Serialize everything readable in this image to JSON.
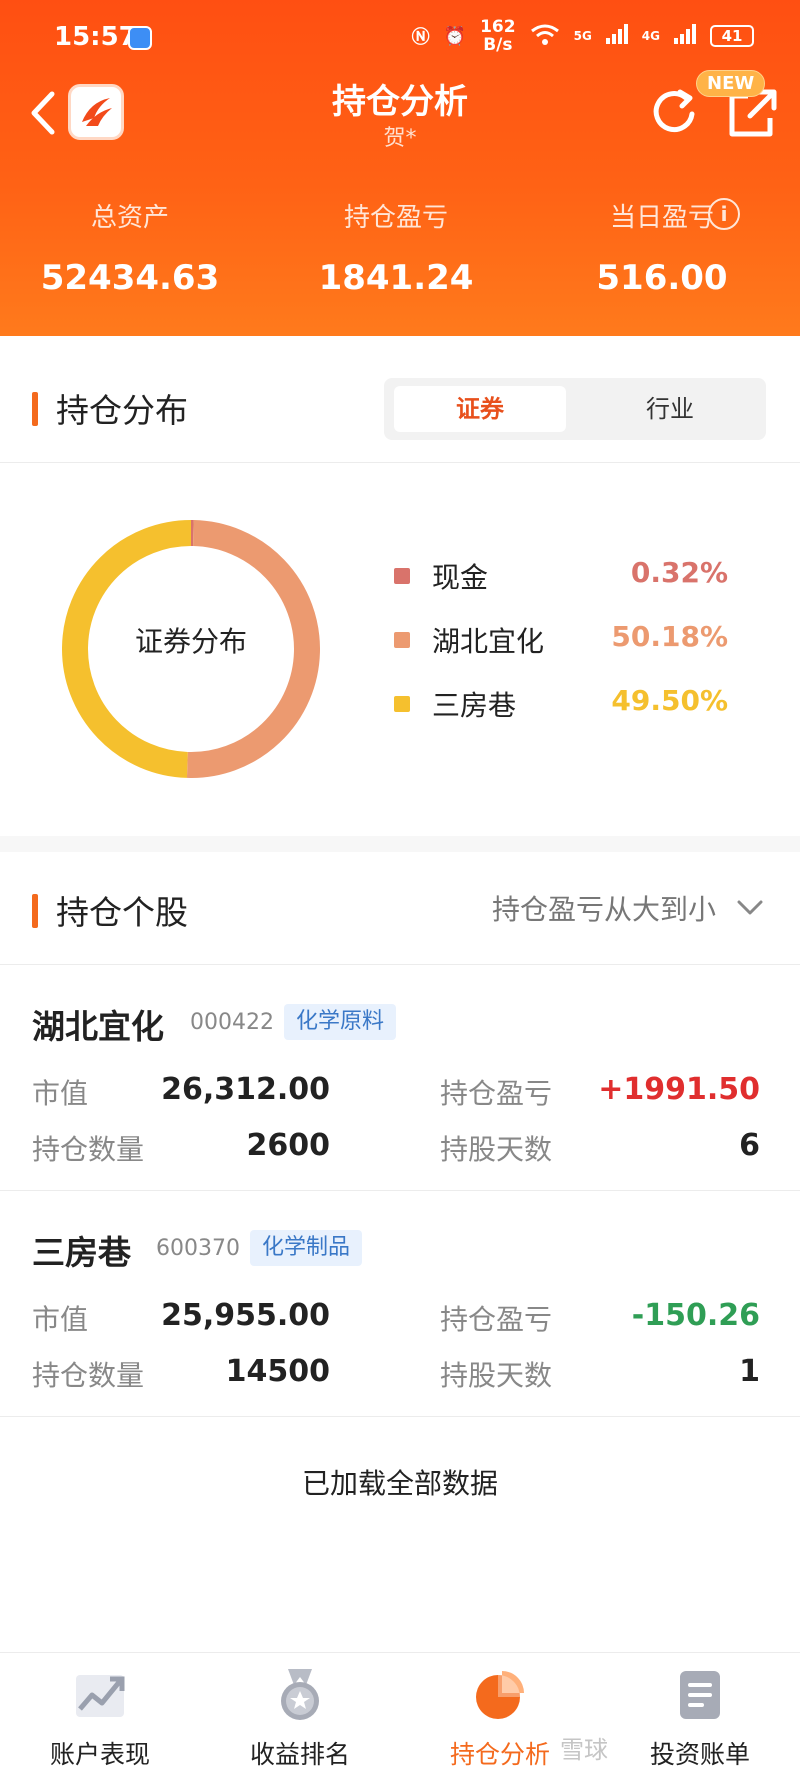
{
  "status": {
    "time": "15:57",
    "speed_value": "162",
    "speed_unit": "B/s",
    "net1": "5G",
    "net2": "4G",
    "battery": "41"
  },
  "nav": {
    "title": "持仓分析",
    "subtitle": "贺*",
    "new_badge": "NEW"
  },
  "summary": {
    "total_assets_label": "总资产",
    "total_assets": "52434.63",
    "position_pl_label": "持仓盈亏",
    "position_pl": "1841.24",
    "daily_pl_label": "当日盈亏",
    "daily_pl": "516.00"
  },
  "distribution": {
    "title": "持仓分布",
    "tab_securities": "证券",
    "tab_industry": "行业",
    "center_label": "证券分布"
  },
  "chart_data": {
    "type": "pie",
    "categories": [
      "现金",
      "湖北宜化",
      "三房巷"
    ],
    "values": [
      0.32,
      50.18,
      49.5
    ],
    "labels": [
      "0.32%",
      "50.18%",
      "49.50%"
    ],
    "colors": [
      "#d9736b",
      "#ec9a70",
      "#f5c02e"
    ]
  },
  "holdings": {
    "title": "持仓个股",
    "sort_label": "持仓盈亏从大到小",
    "stocks": [
      {
        "name": "湖北宜化",
        "code": "000422",
        "tag": "化学原料",
        "market_value_label": "市值",
        "market_value": "26,312.00",
        "pl_label": "持仓盈亏",
        "pl": "+1991.50",
        "pl_color": "#e02e2e",
        "qty_label": "持仓数量",
        "qty": "2600",
        "days_label": "持股天数",
        "days": "6"
      },
      {
        "name": "三房巷",
        "code": "600370",
        "tag": "化学制品",
        "market_value_label": "市值",
        "market_value": "25,955.00",
        "pl_label": "持仓盈亏",
        "pl": "-150.26",
        "pl_color": "#2f9e55",
        "qty_label": "持仓数量",
        "qty": "14500",
        "days_label": "持股天数",
        "days": "1"
      }
    ],
    "loaded_text": "已加载全部数据"
  },
  "tabbar": {
    "tabs": [
      {
        "label": "账户表现",
        "icon": "chart-up-icon"
      },
      {
        "label": "收益排名",
        "icon": "medal-icon"
      },
      {
        "label": "持仓分析",
        "icon": "pie-chart-icon"
      },
      {
        "label": "投资账单",
        "icon": "bill-icon"
      }
    ],
    "active_color": "#f46a1d"
  },
  "watermark": "雪球"
}
